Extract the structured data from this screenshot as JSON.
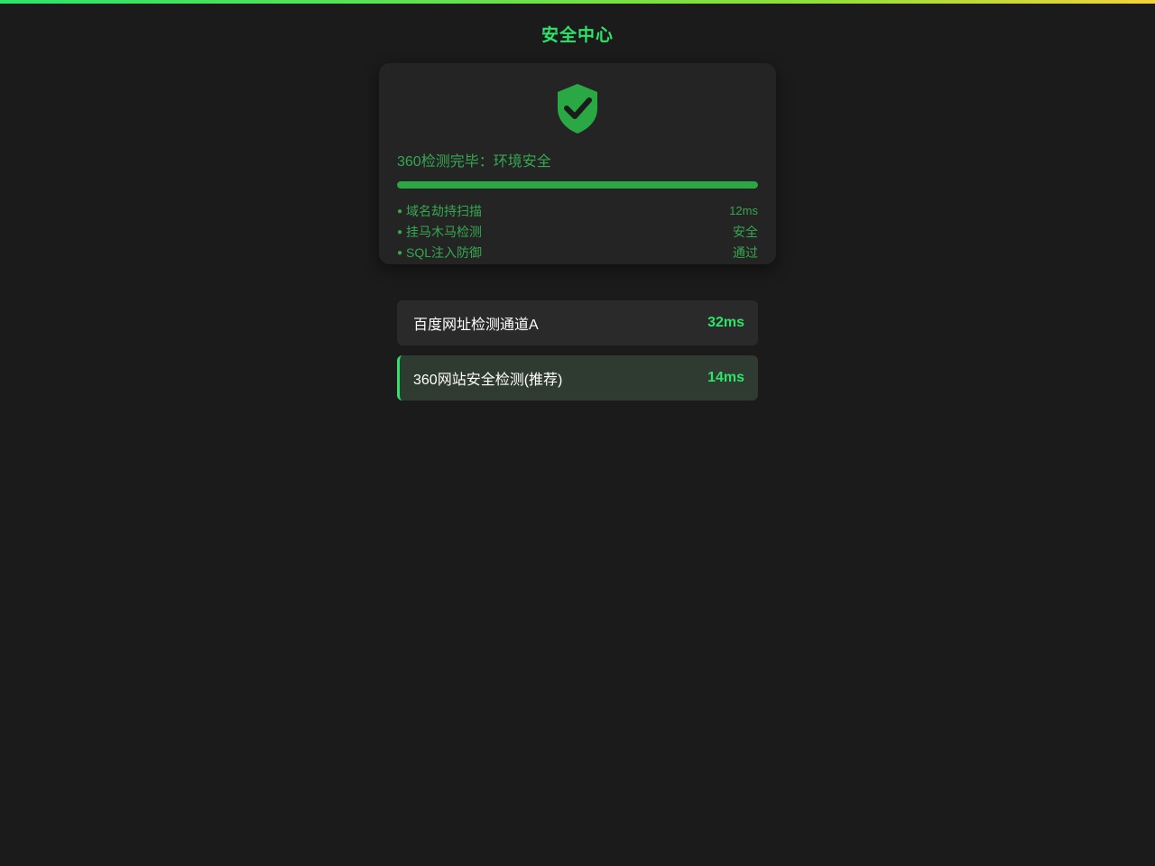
{
  "header": {
    "title": "安全中心"
  },
  "scan": {
    "shield_icon": "shield-check-icon",
    "status": "360检测完毕：环境安全",
    "progress": 1.0,
    "checks": [
      {
        "label": "域名劫持扫描",
        "value": "12ms"
      },
      {
        "label": "挂马木马检测",
        "value": "安全"
      },
      {
        "label": "SQL注入防御",
        "value": "通过"
      }
    ]
  },
  "channels": [
    {
      "name": "百度网址检测通道A",
      "latency": "32ms",
      "selected": false
    },
    {
      "name": "360网站安全检测(推荐)",
      "latency": "14ms",
      "selected": true
    }
  ],
  "colors": {
    "accent": "#2de36a",
    "status_green": "#35a84f",
    "background": "#1b1b1b",
    "card": "#242424",
    "selected_channel": "#2f3a30"
  }
}
